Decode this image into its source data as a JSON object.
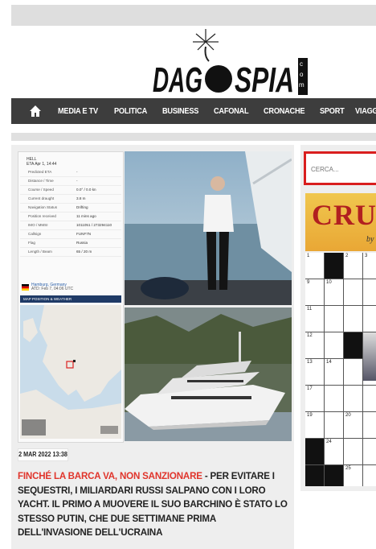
{
  "brand": {
    "name_part1": "DAG",
    "name_part2": "SPIA",
    "domain_letters": "c o m"
  },
  "nav": {
    "items": [
      "MEDIA E TV",
      "POLITICA",
      "BUSINESS",
      "CAFONAL",
      "CRONACHE",
      "SPORT",
      "VIAGGI"
    ]
  },
  "search": {
    "placeholder": "CERCA..."
  },
  "crossword": {
    "title": "CRUC",
    "byline": "by",
    "numbers": [
      "1",
      "2",
      "3",
      "9",
      "10",
      "11",
      "12",
      "13",
      "14",
      "17",
      "19",
      "20",
      "24",
      "25"
    ]
  },
  "map_panel": {
    "vessel_title": "HELL",
    "vessel_sub": "ETA Apr 1, 14:44",
    "rows": [
      {
        "k": "Predicted ETA",
        "v": "-"
      },
      {
        "k": "Distance / Time",
        "v": "-"
      },
      {
        "k": "Course / Speed",
        "v": "0.0° / 0.0 kn"
      },
      {
        "k": "Current draught",
        "v": "3.8 m"
      },
      {
        "k": "Navigation Status",
        "v": "Drifting"
      },
      {
        "k": "Position received",
        "v": "11 mins ago"
      },
      {
        "k": "IMO / MMSI",
        "v": "1011051 / 273294110"
      },
      {
        "k": "Callsign",
        "v": "FUNF7N"
      },
      {
        "k": "Flag",
        "v": "Russia"
      },
      {
        "k": "Length / Beam",
        "v": "65 / 20 m"
      }
    ],
    "port": "Hamburg, Germany",
    "port_sub": "ATD: Feb 7, 04:06 UTC",
    "section_header": "MAP POSITION & WEATHER"
  },
  "article": {
    "date": "2 MAR 2022 13:38",
    "headline_red": "FINCHÉ LA BARCA VA, NON SANZIONARE",
    "headline_rest": " - PER EVITARE I SEQUESTRI, I MILIARDARI RUSSI SALPANO CON I LORO YACHT. IL PRIMO A MUOVERE IL SUO BARCHINO È STATO LO STESSO PUTIN, CHE DUE SETTIMANE PRIMA DELL'INVASIONE DELL'UCRAINA"
  },
  "colors": {
    "nav_bg": "#3d3d3d",
    "accent_red": "#e0342b",
    "search_border": "#d91e1e"
  }
}
